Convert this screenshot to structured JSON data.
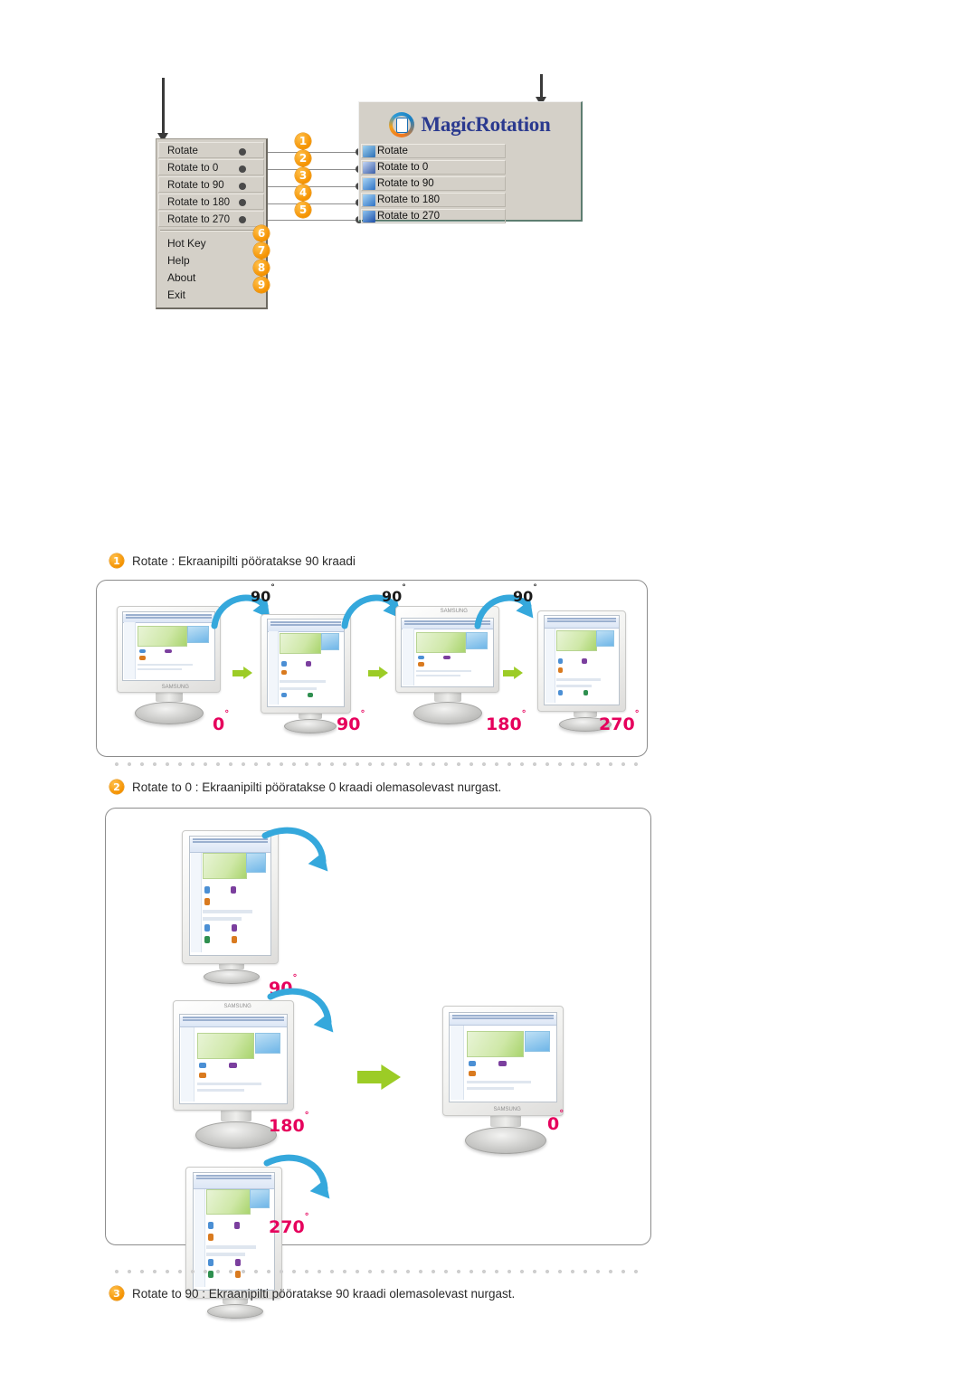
{
  "top_diagram": {
    "context_menu": {
      "name": "magicrotation-tray-menu",
      "boxed_items": [
        "Rotate",
        "Rotate to 0",
        "Rotate to 90",
        "Rotate to 180",
        "Rotate to 270"
      ],
      "plain_items": [
        "Hot Key",
        "Help",
        "About",
        "Exit"
      ]
    },
    "magic_window": {
      "brand": "MagicRotation",
      "logo_icon": "magicrotation-logo-icon",
      "items": [
        {
          "label": "Rotate",
          "icon": "rotate-icon",
          "icon_color": "#2d6fb5"
        },
        {
          "label": "Rotate to 0",
          "icon": "rotate-to-0-icon",
          "icon_color": "#3c5fa8"
        },
        {
          "label": "Rotate to 90",
          "icon": "rotate-to-90-icon",
          "icon_color": "#2f72c4"
        },
        {
          "label": "Rotate to 180",
          "icon": "rotate-to-180-icon",
          "icon_color": "#2f72c4"
        },
        {
          "label": "Rotate to 270",
          "icon": "rotate-to-270-icon",
          "icon_color": "#1f4fa8"
        }
      ]
    },
    "callouts": [
      "1",
      "2",
      "3",
      "4",
      "5",
      "6",
      "7",
      "8",
      "9"
    ]
  },
  "sections": [
    {
      "number": "1",
      "caption": "Rotate :  Ekraanipilti pööratakse 90 kraadi",
      "diagram": {
        "type": "rotation-sequence-horizontal",
        "step_rotation_label": "90",
        "monitor_angles": [
          "0",
          "90",
          "180",
          "270"
        ],
        "arrows": [
          "90",
          "90",
          "90"
        ]
      }
    },
    {
      "number": "2",
      "caption": "Rotate to 0 : Ekraanipilti pööratakse 0 kraadi olemasolevast nurgast.",
      "diagram": {
        "type": "rotation-converge-to-0",
        "source_angles": [
          "90",
          "180",
          "270"
        ],
        "target_angle": "0"
      }
    },
    {
      "number": "3",
      "caption": "Rotate to 90 : Ekraanipilti pööratakse 90 kraadi olemasolevast nurgast."
    }
  ],
  "colors": {
    "badge_orange": "#f59200",
    "degree_red": "#e6005c",
    "arrow_green": "#9ccc26",
    "arrow_blue": "#35a8dc",
    "brand_blue": "#2b3a8f",
    "window_gray": "#d4d0c8"
  }
}
